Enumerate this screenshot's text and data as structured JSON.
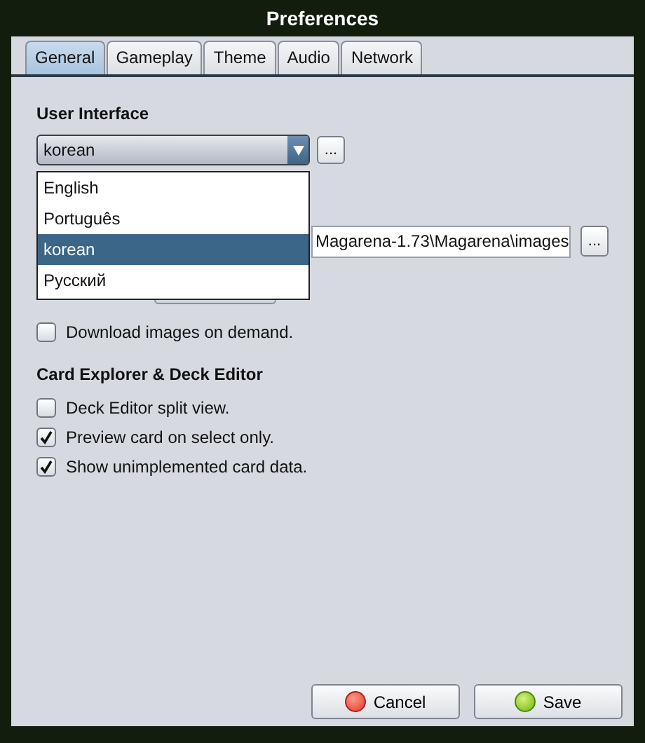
{
  "window": {
    "title": "Preferences"
  },
  "tabs": [
    {
      "label": "General",
      "selected": true
    },
    {
      "label": "Gameplay",
      "selected": false
    },
    {
      "label": "Theme",
      "selected": false
    },
    {
      "label": "Audio",
      "selected": false
    },
    {
      "label": "Network",
      "selected": false
    }
  ],
  "user_interface": {
    "heading": "User Interface",
    "language": "korean",
    "more_button": "...",
    "open": true,
    "options": [
      {
        "label": "English",
        "selected": false
      },
      {
        "label": "Português",
        "selected": false
      },
      {
        "label": "korean",
        "selected": true
      },
      {
        "label": "Русский",
        "selected": false
      }
    ]
  },
  "images_folder": {
    "value": "Magarena-1.73\\Magarena\\images",
    "browse_button": "..."
  },
  "download_on_demand": {
    "label": "Download images on demand.",
    "checked": false
  },
  "card_explorer": {
    "heading": "Card Explorer & Deck Editor",
    "options": [
      {
        "label": "Deck Editor split view.",
        "checked": false
      },
      {
        "label": "Preview card on select only.",
        "checked": true
      },
      {
        "label": "Show unimplemented card data.",
        "checked": true
      }
    ]
  },
  "buttons": [
    {
      "label": "Cancel",
      "kind": "cancel"
    },
    {
      "label": "Save",
      "kind": "save"
    }
  ]
}
